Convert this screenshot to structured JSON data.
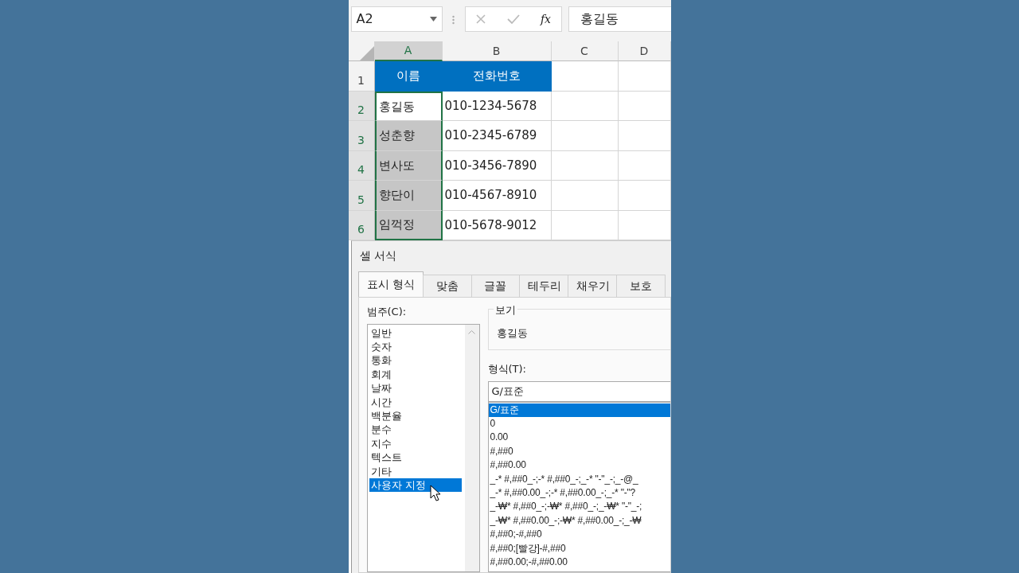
{
  "name_box": {
    "value": "A2"
  },
  "formula_bar": {
    "function_label": "fx",
    "value": "홍길동"
  },
  "columns": [
    {
      "label": "A",
      "selected": true
    },
    {
      "label": "B",
      "selected": false
    },
    {
      "label": "C",
      "selected": false
    },
    {
      "label": "D",
      "selected": false
    }
  ],
  "rows": [
    {
      "number": "1",
      "selected": false,
      "cells": [
        {
          "text": "이름",
          "kind": "header",
          "selected": false,
          "active": false
        },
        {
          "text": "전화번호",
          "kind": "header",
          "selected": false,
          "active": false
        },
        {
          "kind": "data",
          "selected": false,
          "active": false
        },
        {
          "kind": "data",
          "selected": false,
          "active": false
        }
      ]
    },
    {
      "number": "2",
      "selected": true,
      "cells": [
        {
          "text": "홍길동",
          "kind": "data",
          "selected": true,
          "active": true
        },
        {
          "text": "010-1234-5678",
          "kind": "data",
          "selected": false,
          "active": false
        },
        {
          "kind": "data",
          "selected": false,
          "active": false
        },
        {
          "kind": "data",
          "selected": false,
          "active": false
        }
      ]
    },
    {
      "number": "3",
      "selected": true,
      "cells": [
        {
          "text": "성춘향",
          "kind": "data",
          "selected": true,
          "active": false
        },
        {
          "text": "010-2345-6789",
          "kind": "data",
          "selected": false,
          "active": false
        },
        {
          "kind": "data",
          "selected": false,
          "active": false
        },
        {
          "kind": "data",
          "selected": false,
          "active": false
        }
      ]
    },
    {
      "number": "4",
      "selected": true,
      "cells": [
        {
          "text": "변사또",
          "kind": "data",
          "selected": true,
          "active": false
        },
        {
          "text": "010-3456-7890",
          "kind": "data",
          "selected": false,
          "active": false
        },
        {
          "kind": "data",
          "selected": false,
          "active": false
        },
        {
          "kind": "data",
          "selected": false,
          "active": false
        }
      ]
    },
    {
      "number": "5",
      "selected": true,
      "cells": [
        {
          "text": "향단이",
          "kind": "data",
          "selected": true,
          "active": false
        },
        {
          "text": "010-4567-8910",
          "kind": "data",
          "selected": false,
          "active": false
        },
        {
          "kind": "data",
          "selected": false,
          "active": false
        },
        {
          "kind": "data",
          "selected": false,
          "active": false
        }
      ]
    },
    {
      "number": "6",
      "selected": true,
      "cells": [
        {
          "text": "임꺽정",
          "kind": "data",
          "selected": true,
          "active": false
        },
        {
          "text": "010-5678-9012",
          "kind": "data",
          "selected": false,
          "active": false
        },
        {
          "kind": "data",
          "selected": false,
          "active": false
        },
        {
          "kind": "data",
          "selected": false,
          "active": false
        }
      ]
    }
  ],
  "dialog": {
    "title": "셀 서식",
    "tabs": [
      {
        "label": "표시 형식",
        "selected": true
      },
      {
        "label": "맞춤",
        "selected": false
      },
      {
        "label": "글꼴",
        "selected": false
      },
      {
        "label": "테두리",
        "selected": false
      },
      {
        "label": "채우기",
        "selected": false
      },
      {
        "label": "보호",
        "selected": false
      }
    ],
    "category_label": "범주(C):",
    "categories": [
      {
        "label": "일반",
        "selected": false
      },
      {
        "label": "숫자",
        "selected": false
      },
      {
        "label": "통화",
        "selected": false
      },
      {
        "label": "회계",
        "selected": false
      },
      {
        "label": "날짜",
        "selected": false
      },
      {
        "label": "시간",
        "selected": false
      },
      {
        "label": "백분율",
        "selected": false
      },
      {
        "label": "분수",
        "selected": false
      },
      {
        "label": "지수",
        "selected": false
      },
      {
        "label": "텍스트",
        "selected": false
      },
      {
        "label": "기타",
        "selected": false
      },
      {
        "label": "사용자 지정",
        "selected": true
      }
    ],
    "preview": {
      "legend": "보기",
      "value": "홍길동"
    },
    "format_label": "형식(T):",
    "format_input": {
      "value": "G/표준"
    },
    "formats": [
      {
        "label": "G/표준",
        "selected": true
      },
      {
        "label": "0",
        "selected": false
      },
      {
        "label": "0.00",
        "selected": false
      },
      {
        "label": "#,##0",
        "selected": false
      },
      {
        "label": "#,##0.00",
        "selected": false
      },
      {
        "label": "_-* #,##0_-;-* #,##0_-;_-* \"-\"_-;_-@_",
        "selected": false
      },
      {
        "label": "_-* #,##0.00_-;-* #,##0.00_-;_-* \"-\"?",
        "selected": false
      },
      {
        "label": "_-₩* #,##0_-;-₩* #,##0_-;_-₩* \"-\"_-;",
        "selected": false
      },
      {
        "label": "_-₩* #,##0.00_-;-₩* #,##0.00_-;_-₩",
        "selected": false
      },
      {
        "label": "#,##0;-#,##0",
        "selected": false
      },
      {
        "label": "#,##0;[빨강]-#,##0",
        "selected": false
      },
      {
        "label": "#,##0.00;-#,##0.00",
        "selected": false
      }
    ]
  }
}
